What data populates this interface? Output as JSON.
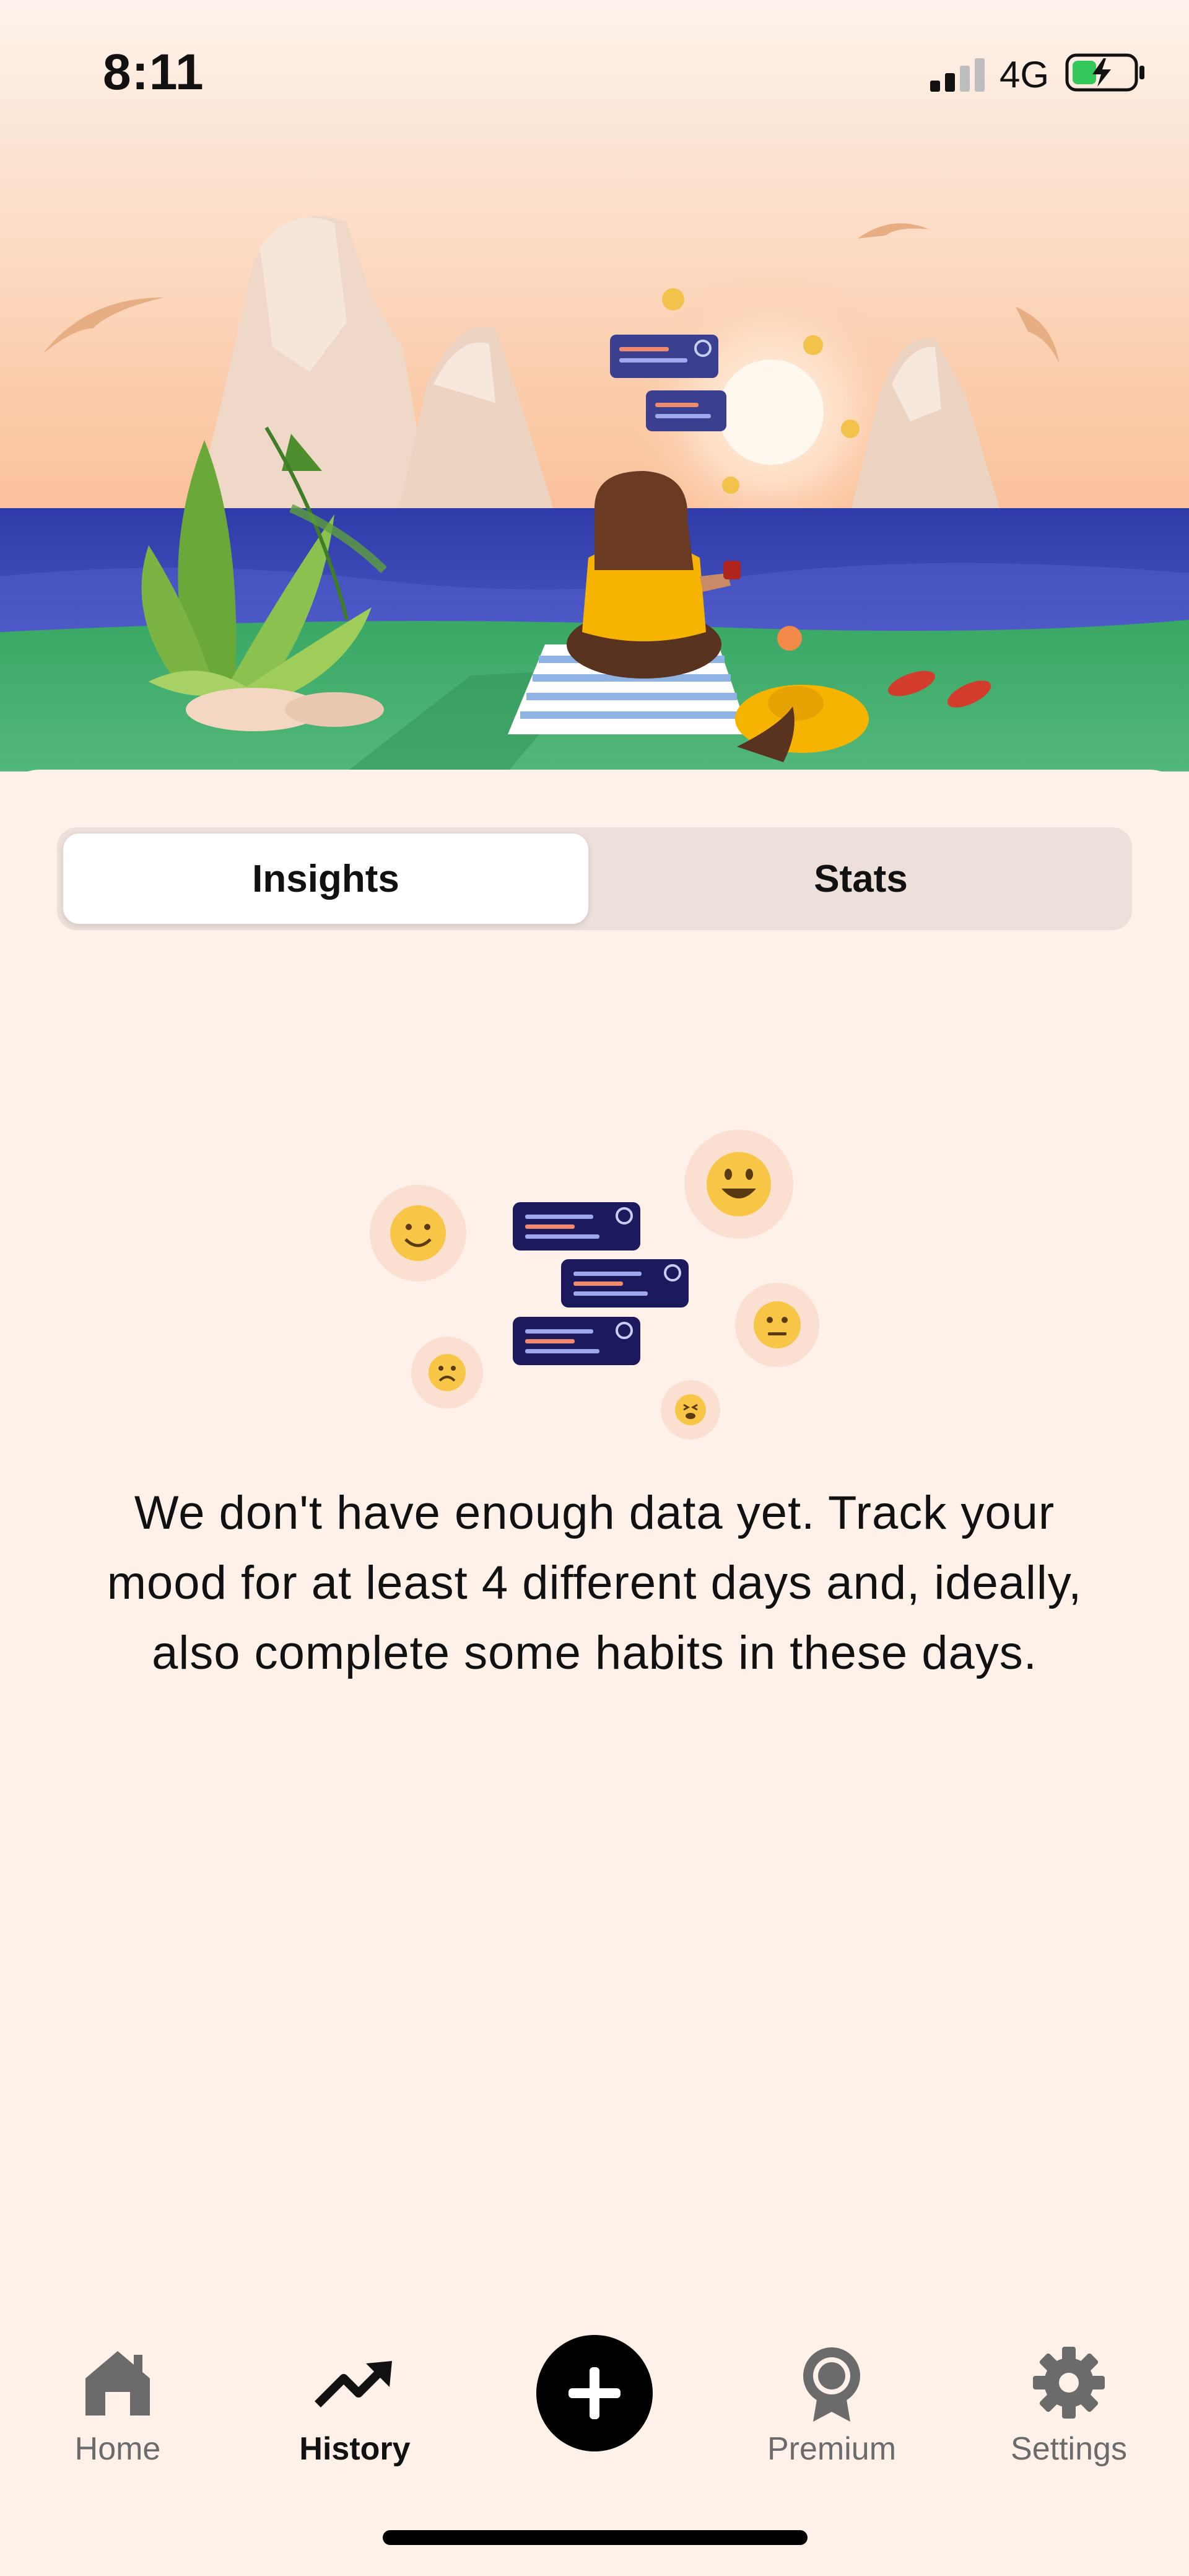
{
  "status_bar": {
    "time": "8:11",
    "network": "4G"
  },
  "tabs_segment": {
    "insights_label": "Insights",
    "stats_label": "Stats",
    "selected": "Insights"
  },
  "empty_state": {
    "message": "We don't have enough data yet. Track your mood for at least 4 different days and, ideally, also complete some habits in these days."
  },
  "tab_bar": {
    "items": [
      {
        "label": "Home",
        "icon": "house-icon"
      },
      {
        "label": "History",
        "icon": "trending-up-icon"
      },
      {
        "label": "",
        "icon": "plus-icon"
      },
      {
        "label": "Premium",
        "icon": "award-icon"
      },
      {
        "label": "Settings",
        "icon": "gear-icon"
      }
    ],
    "active": "History"
  },
  "colors": {
    "background": "#fdf1ea",
    "segment_track": "#ede0da",
    "accent_dark": "#000000",
    "card_navy": "#1c1a5c"
  }
}
